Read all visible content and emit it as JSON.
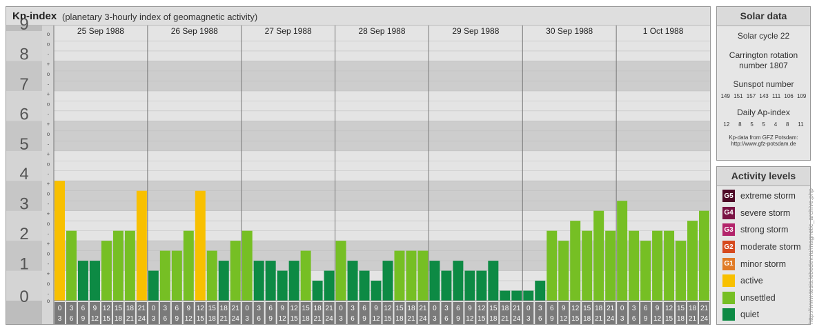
{
  "header": {
    "title": "Kp-index",
    "subtitle": "(planetary 3-hourly index of geomagnetic activity)"
  },
  "chart_data": {
    "type": "bar",
    "ylim": [
      0,
      9
    ],
    "y_tick_labels": [
      "0",
      "1",
      "2",
      "3",
      "4",
      "5",
      "6",
      "7",
      "8",
      "9"
    ],
    "sub_tick_labels": [
      "+",
      "o",
      "-"
    ],
    "days": [
      "25 Sep 1988",
      "26 Sep 1988",
      "27 Sep 1988",
      "28 Sep 1988",
      "29 Sep 1988",
      "30 Sep 1988",
      "1 Oct 1988"
    ],
    "interval_labels": [
      [
        "0",
        "3"
      ],
      [
        "3",
        "6"
      ],
      [
        "6",
        "9"
      ],
      [
        "9",
        "12"
      ],
      [
        "12",
        "15"
      ],
      [
        "15",
        "18"
      ],
      [
        "18",
        "21"
      ],
      [
        "21",
        "24"
      ]
    ],
    "values": [
      4.0,
      2.333,
      1.333,
      1.333,
      2.0,
      2.333,
      2.333,
      3.667,
      1.0,
      1.667,
      1.667,
      2.333,
      3.667,
      1.667,
      1.333,
      2.0,
      2.333,
      1.333,
      1.333,
      1.0,
      1.333,
      1.667,
      0.667,
      1.0,
      2.0,
      1.333,
      1.0,
      0.667,
      1.333,
      1.667,
      1.667,
      1.667,
      1.333,
      1.0,
      1.333,
      1.0,
      1.0,
      1.333,
      0.333,
      0.333,
      0.333,
      0.667,
      2.333,
      2.0,
      2.667,
      2.333,
      3.0,
      2.333,
      3.333,
      2.333,
      2.0,
      2.333,
      2.333,
      2.0,
      2.667,
      3.0
    ],
    "grid": true,
    "legend": "right"
  },
  "colors": {
    "quiet": "#0d8a44",
    "unsettled": "#76bf24",
    "active": "#f8c000",
    "g1": "#e07b26",
    "g2": "#d64a1e",
    "g3": "#b3246b",
    "g4": "#7a1344",
    "g5": "#4e0a27",
    "band_dark": "#cdcdcd",
    "band_light": "#e4e4e4",
    "tick_bg": "#7a7a7a"
  },
  "solar": {
    "header": "Solar data",
    "cycle": "Solar cycle 22",
    "carrington_line1": "Carrington rotation",
    "carrington_line2": "number 1807",
    "sunspot_title": "Sunspot number",
    "sunspot_values": [
      "149",
      "151",
      "157",
      "143",
      "111",
      "106",
      "109"
    ],
    "ap_title": "Daily Ap-index",
    "ap_values": [
      "12",
      "8",
      "5",
      "5",
      "4",
      "8",
      "11"
    ],
    "source_line1": "Kp-data from GFZ Potsdam:",
    "source_line2": "http://www.gfz-potsdam.de"
  },
  "activity": {
    "header": "Activity levels",
    "items": [
      {
        "code": "G5",
        "label": "extreme storm",
        "color": "#4e0a27"
      },
      {
        "code": "G4",
        "label": "severe storm",
        "color": "#7a1344"
      },
      {
        "code": "G3",
        "label": "strong storm",
        "color": "#b3246b"
      },
      {
        "code": "G2",
        "label": "moderate storm",
        "color": "#d64a1e"
      },
      {
        "code": "G1",
        "label": "minor storm",
        "color": "#e07b26"
      },
      {
        "code": "",
        "label": "active",
        "color": "#f8c000"
      },
      {
        "code": "",
        "label": "unsettled",
        "color": "#76bf24"
      },
      {
        "code": "",
        "label": "quiet",
        "color": "#0d8a44"
      }
    ]
  },
  "watermark": "http://www.tesis.lebedev.ru/magnetic_archive.php"
}
